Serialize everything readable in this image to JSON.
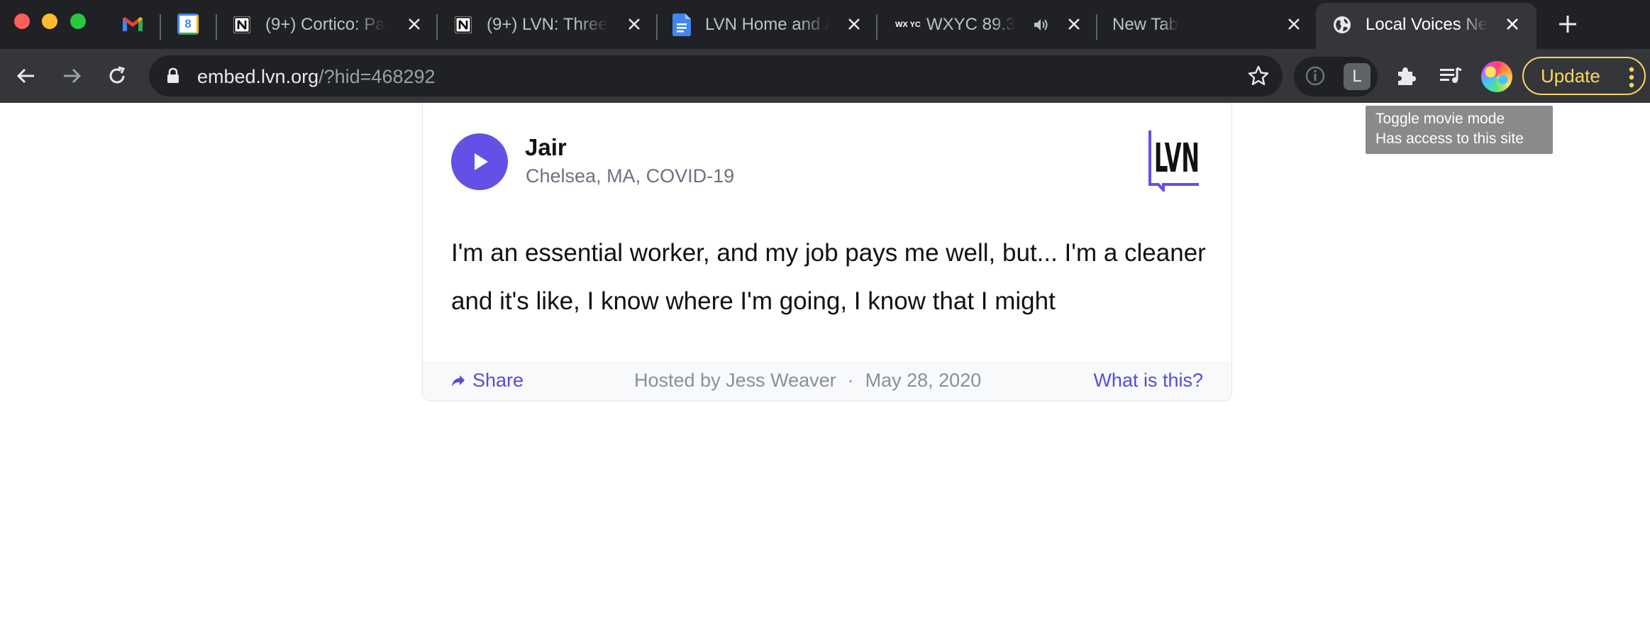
{
  "browser": {
    "tabs": [
      {
        "title": "(9+) Cortico: Pa",
        "favicon": "notion-icon"
      },
      {
        "title": "(9+) LVN: Three",
        "favicon": "notion-icon"
      },
      {
        "title": "LVN Home and /",
        "favicon": "google-docs-icon"
      },
      {
        "title": "WXYC 89.3",
        "favicon": "wxyc-icon"
      },
      {
        "title": "New Tab",
        "favicon": ""
      }
    ],
    "active_tab": {
      "title": "Local Voices Ne",
      "favicon": "globe-icon"
    },
    "pinned_tabs": [
      "gmail-icon",
      "google-calendar-icon"
    ],
    "calendar_day": "8",
    "wxyc_favicon_text": "WX YC",
    "url_host": "embed.lvn.org",
    "url_path": "/?hid=468292",
    "extension_letter": "L",
    "update_label": "Update",
    "tooltip": {
      "line1": "Toggle movie mode",
      "line2": "Has access to this site"
    }
  },
  "embed": {
    "speaker_name": "Jair",
    "speaker_meta": "Chelsea, MA, COVID-19",
    "logo_text": "LVN",
    "quote": "I'm an essential worker, and my job pays me well, but... I'm a cleaner and it's like, I know where I'm going, I know that I might",
    "share_label": "Share",
    "hosted_by": "Hosted by Jess Weaver",
    "separator": "·",
    "date": "May 28, 2020",
    "what_is_this": "What is this?",
    "accent_color": "#6450e6"
  }
}
